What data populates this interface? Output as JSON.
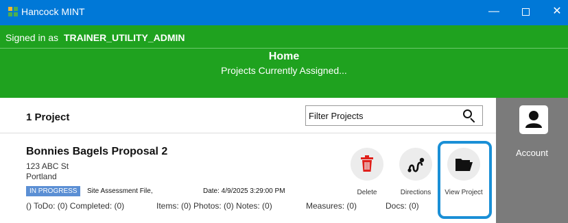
{
  "window": {
    "title": "Hancock MINT",
    "minimize_glyph": "—",
    "close_glyph": "✕"
  },
  "header": {
    "signed_in_prefix": "Signed in as",
    "username": "TRAINER_UTILITY_ADMIN",
    "page_title": "Home",
    "subtitle": "Projects Currently Assigned..."
  },
  "list": {
    "count_label": "1 Project",
    "filter_text": "Filter Projects"
  },
  "projects": [
    {
      "name": "Bonnies Bagels Proposal 2",
      "address_line1": "123 ABC St",
      "address_line2": "Portland",
      "status": "IN PROGRESS",
      "file_type": "Site Assessment File,",
      "date": "Date: 4/9/2025 3:29:00 PM",
      "todo_stats": "() ToDo: (0) Completed: (0)",
      "items_stats": "Items: (0) Photos: (0) Notes: (0)",
      "measures": "Measures: (0)",
      "docs": "Docs: (0)",
      "actions": {
        "delete": "Delete",
        "directions": "Directions",
        "view": "View Project"
      }
    }
  ],
  "sidebar": {
    "account_label": "Account"
  },
  "colors": {
    "titlebar": "#0078d7",
    "header_green": "#1fa21f",
    "delete_red": "#e0201b",
    "badge_blue": "#5b8fd4",
    "highlight_blue": "#1a8fd6",
    "sidebar_gray": "#7b7b7b"
  },
  "icons": {
    "app": "app-logo-icon",
    "search": "search-icon",
    "delete": "trash-icon",
    "directions": "route-icon",
    "view": "folder-open-icon",
    "account": "person-icon"
  }
}
